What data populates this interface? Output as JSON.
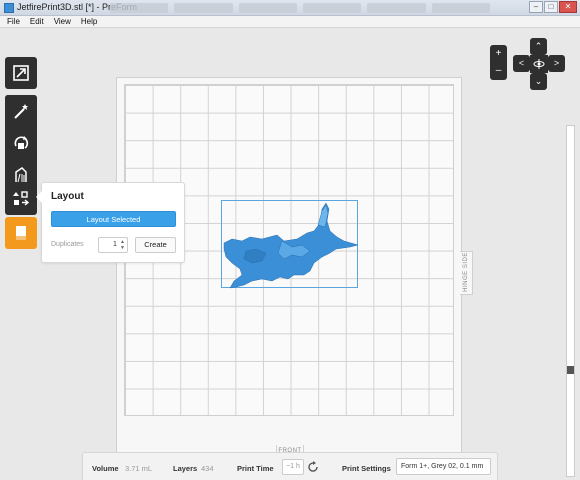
{
  "window": {
    "title": "JetfirePrint3D.stl [*] - PreForm",
    "controls": {
      "minimize": "–",
      "maximize": "□",
      "close": "✕"
    }
  },
  "menu": [
    "File",
    "Edit",
    "View",
    "Help"
  ],
  "toolbar": {
    "items": [
      {
        "icon": "expand-icon",
        "active": false
      },
      {
        "icon": "magic-wand-icon",
        "active": false
      },
      {
        "icon": "rotate-icon",
        "active": false
      },
      {
        "icon": "supports-icon",
        "active": false
      },
      {
        "icon": "layout-icon",
        "active": true
      },
      {
        "icon": "print-icon",
        "active": false
      }
    ]
  },
  "layout_panel": {
    "title": "Layout",
    "primary_button": "Layout Selected",
    "duplicates_label": "Duplicates",
    "duplicates_value": "1",
    "create_button": "Create"
  },
  "platform": {
    "front_label": "FRONT",
    "hinge_label": "HINGE SIDE"
  },
  "view_controls": {
    "zoom_in": "+",
    "zoom_out": "–",
    "nav_up": "⌃",
    "nav_down": "⌄",
    "nav_left": "<",
    "nav_right": ">"
  },
  "status": {
    "volume_label": "Volume",
    "volume_value": "3.71 mL",
    "layers_label": "Layers",
    "layers_value": "434",
    "print_time_label": "Print Time",
    "print_time_value": "~1 h",
    "print_settings_label": "Print Settings",
    "print_settings_value": "Form 1+, Grey 02, 0.1 mm"
  },
  "colors": {
    "accent": "#3aa0e8",
    "toolbar": "#2f2f2f",
    "active_tool": "#f39a1e",
    "model": "#3b8fd6"
  }
}
